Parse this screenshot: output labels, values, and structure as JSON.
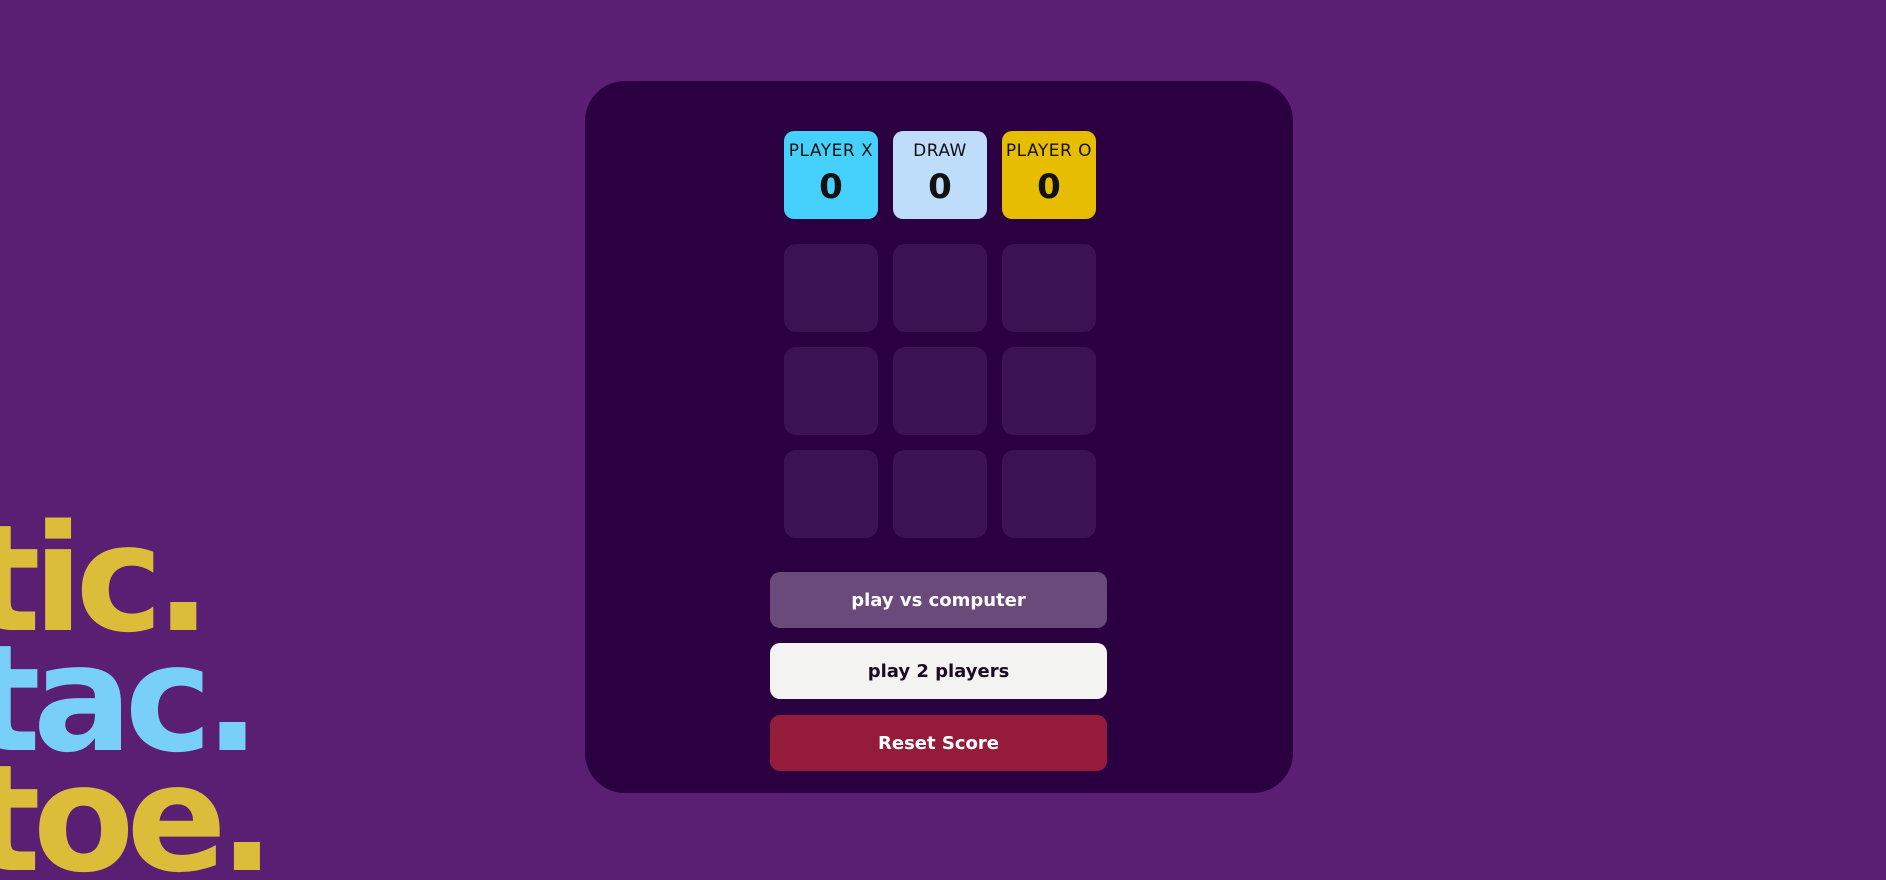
{
  "scoreboard": {
    "player_x": {
      "label": "PLAYER X",
      "value": "0",
      "color": "#45d1fb"
    },
    "draw": {
      "label": "DRAW",
      "value": "0",
      "color": "#bdddfb"
    },
    "player_o": {
      "label": "PLAYER O",
      "value": "0",
      "color": "#e6bd00"
    }
  },
  "board": {
    "cells": [
      "",
      "",
      "",
      "",
      "",
      "",
      "",
      "",
      ""
    ]
  },
  "buttons": {
    "vs_computer": "play vs computer",
    "two_players": "play 2 players",
    "reset": "Reset Score"
  },
  "logo": {
    "line1": "tic.",
    "line2": "tac.",
    "line3": "toe."
  },
  "colors": {
    "background": "#5a1e73",
    "panel": "#2a0040",
    "cell": "#3c1352",
    "reset": "#941c3a"
  }
}
